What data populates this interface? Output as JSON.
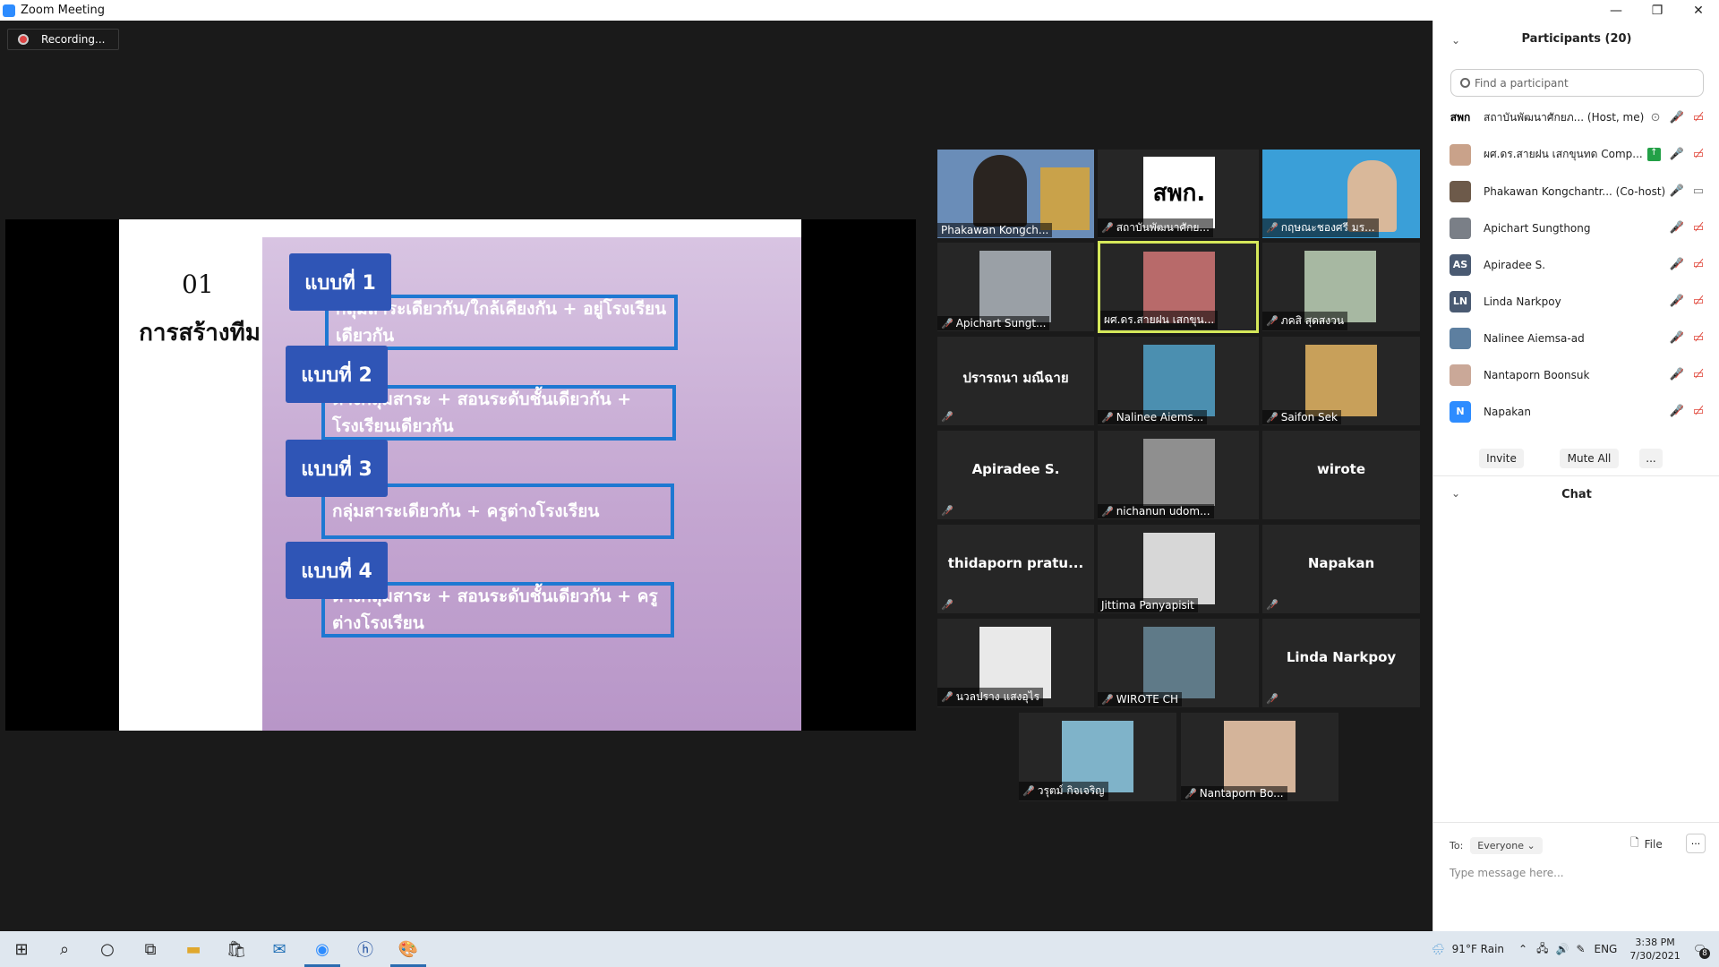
{
  "window": {
    "title": "Zoom Meeting",
    "minimize": "—",
    "maximize": "❐",
    "close": "✕"
  },
  "recording": {
    "label": "Recording..."
  },
  "slide": {
    "number": "01",
    "caption": "การสร้างทีม",
    "items": [
      {
        "tag": "แบบที่ 1",
        "text": "กลุ่มสาระเดียวกัน/ใกล้เคียงกัน + อยู่โรงเรียนเดียวกัน"
      },
      {
        "tag": "แบบที่ 2",
        "text": "ต่างกลุ่มสาระ + สอนระดับชั้นเดียวกัน + โรงเรียนเดียวกัน"
      },
      {
        "tag": "แบบที่ 3",
        "text": "กลุ่มสาระเดียวกัน + ครูต่างโรงเรียน"
      },
      {
        "tag": "แบบที่ 4",
        "text": "ต่างกลุ่มสาระ + สอนระดับชั้นเดียวกัน + ครูต่างโรงเรียน"
      }
    ]
  },
  "gallery": {
    "tiles": [
      {
        "name": "Phakawan Kongch...",
        "muted": false,
        "video": true
      },
      {
        "name": "สถาบันพัฒนาศักย...",
        "muted": true,
        "logo": "สพก."
      },
      {
        "name": "กฤษณะชองศรี มร...",
        "muted": true,
        "video": true
      },
      {
        "name": "Apichart Sungt...",
        "muted": true,
        "video": true
      },
      {
        "name": "ผศ.ดร.สายฝน เสกขุน...",
        "muted": true,
        "video": true,
        "active": true
      },
      {
        "name": "ภคสิ สุดสงวน",
        "muted": true,
        "video": true
      },
      {
        "bigname": "ปรารถนา มณีฉาย",
        "muted": true
      },
      {
        "name": "Nalinee Aiems...",
        "muted": true,
        "video": true
      },
      {
        "name": "Saifon Sek",
        "muted": true,
        "video": true
      },
      {
        "bigname": "Apiradee S.",
        "muted": true
      },
      {
        "name": "nichanun udom...",
        "muted": true,
        "video": true
      },
      {
        "bigname": "wirote",
        "muted": false
      },
      {
        "bigname": "thidaporn  pratu...",
        "muted": true
      },
      {
        "name": "Jittima Panyapisit",
        "muted": false,
        "video": true
      },
      {
        "bigname": "Napakan",
        "muted": true
      },
      {
        "name": "นวลปราง  แสงอุไร",
        "muted": true,
        "video": true
      },
      {
        "name": "WIROTE CH",
        "muted": true,
        "video": true
      },
      {
        "bigname": "Linda Narkpoy",
        "muted": true
      },
      {
        "name": "วรุตม์ กิจเจริญ",
        "muted": true,
        "video": true
      },
      {
        "name": "Nantaporn Bo...",
        "muted": true,
        "video": true
      }
    ]
  },
  "participants": {
    "header": "Participants (20)",
    "search_placeholder": "Find a participant",
    "list": [
      {
        "avatar": "สพก",
        "name": "สถาบันพัฒนาศักยภ... (Host, me)",
        "color": "#ffffff"
      },
      {
        "avatar": "",
        "name": "ผศ.ดร.สายฝน เสกขุนทด Comp...",
        "color": "#c9a28a"
      },
      {
        "avatar": "",
        "name": "Phakawan Kongchantr... (Co-host)",
        "color": "#6d5a4a"
      },
      {
        "avatar": "",
        "name": "Apichart Sungthong",
        "color": "#7a7f87"
      },
      {
        "avatar": "AS",
        "name": "Apiradee S.",
        "color": "#4a5a72"
      },
      {
        "avatar": "LN",
        "name": "Linda Narkpoy",
        "color": "#4a5a72"
      },
      {
        "avatar": "",
        "name": "Nalinee Aiemsa-ad",
        "color": "#5d7fa0"
      },
      {
        "avatar": "",
        "name": "Nantaporn Boonsuk",
        "color": "#caa898"
      },
      {
        "avatar": "N",
        "name": "Napakan",
        "color": "#2d8cff"
      }
    ],
    "invite": "Invite",
    "mute_all": "Mute All",
    "more": "..."
  },
  "chat": {
    "header": "Chat",
    "to_label": "To:",
    "to_value": "Everyone",
    "file_label": "File",
    "more": "···",
    "placeholder": "Type message here..."
  },
  "taskbar": {
    "weather": "91°F  Rain",
    "lang": "ENG",
    "time": "3:38 PM",
    "date": "7/30/2021",
    "notif_count": "8"
  },
  "colors": {
    "muted_red": "#e0463a",
    "active_border": "#d5e85a",
    "slide_tag_blue": "#2f55b6",
    "slide_box_border": "#1e78d2",
    "zoom_blue": "#2d8cff"
  }
}
